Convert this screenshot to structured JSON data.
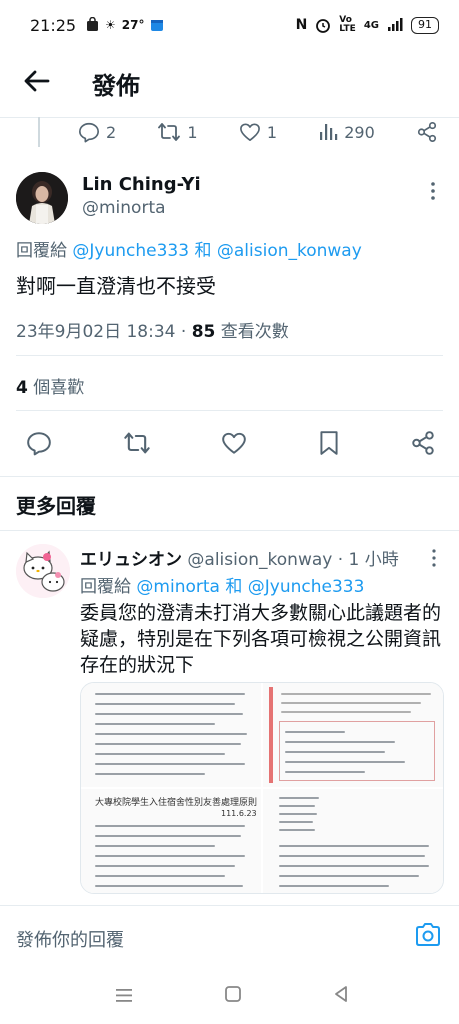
{
  "status_bar": {
    "time": "21:25",
    "temp": "27°",
    "network": "4G",
    "battery": "91"
  },
  "header": {
    "title": "發佈"
  },
  "prev_tweet_actions": {
    "replies": "2",
    "retweets": "1",
    "likes": "1",
    "views": "290"
  },
  "main_tweet": {
    "author_name": "Lin Ching-Yi",
    "author_handle": "@minorta",
    "reply_prefix": "回覆給",
    "reply_user1": "@Jyunche333",
    "reply_and": "和",
    "reply_user2": "@alision_konway",
    "text": "對啊一直澄清也不接受",
    "timestamp": "23年9月02日 18:34",
    "views_count": "85",
    "views_label": "查看次數",
    "likes_count": "4",
    "likes_label": "個喜歡"
  },
  "more_replies_title": "更多回覆",
  "reply_tweet": {
    "author_name": "エリュシオン",
    "author_handle": "@alision_konway",
    "time": "· 1 小時",
    "reply_prefix": "回覆給",
    "reply_user1": "@minorta",
    "reply_and": "和",
    "reply_user2": "@Jyunche333",
    "text": "委員您的澄清未打消大多數關心此議題者的疑慮，特別是在下列各項可檢視之公開資訊存在的狀況下",
    "doc_title": "大專校院學生入住宿舍性別友善處理原則",
    "doc_date": "111.6.23"
  },
  "compose": {
    "placeholder": "發佈你的回覆"
  }
}
